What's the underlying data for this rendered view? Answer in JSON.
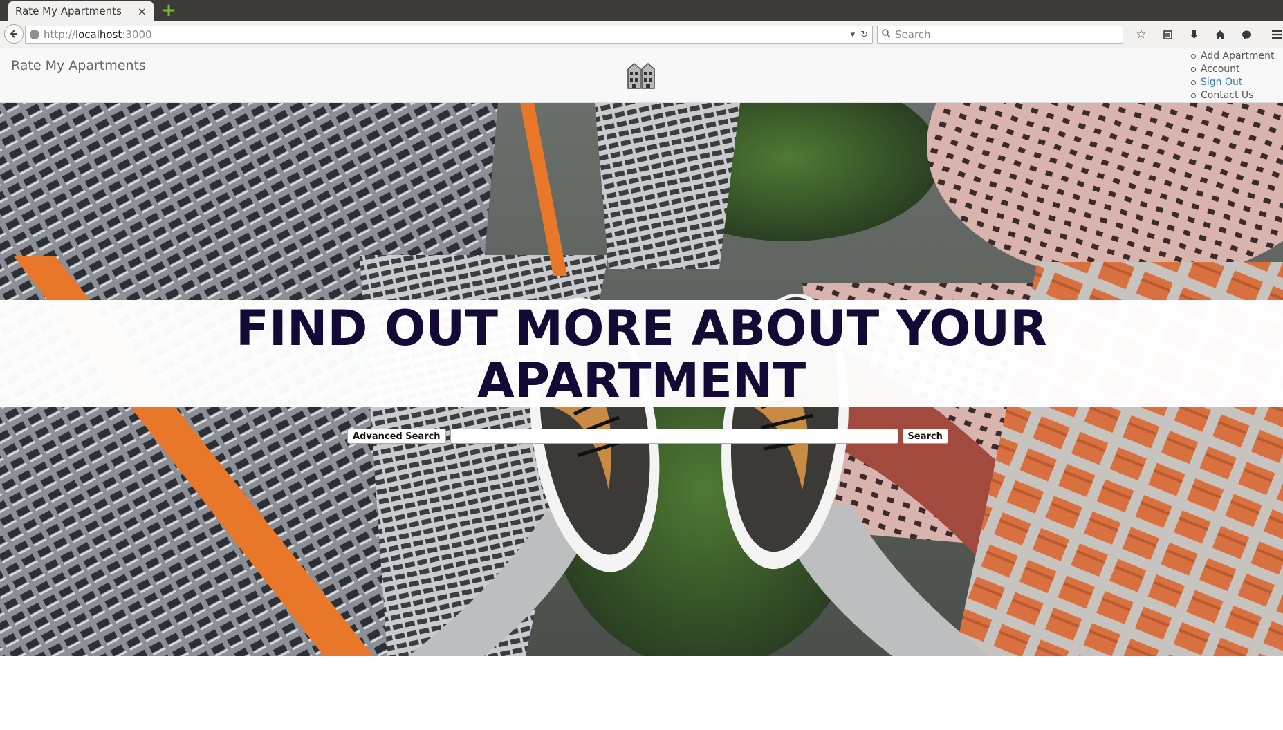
{
  "browser": {
    "tab_title": "Rate My Apartments",
    "tab_close": "×",
    "new_tab": "+",
    "url_scheme": "http://",
    "url_host": "localhost",
    "url_port": ":3000",
    "search_placeholder": "Search",
    "icons": [
      "bookmark-star-icon",
      "reading-list-icon",
      "download-icon",
      "home-icon",
      "chat-icon",
      "menu-icon"
    ]
  },
  "site": {
    "brand": "Rate My Apartments",
    "logo_icon": "building-icon",
    "nav": [
      {
        "label": "Add Apartment"
      },
      {
        "label": "Account"
      },
      {
        "label": "Sign Out"
      },
      {
        "label": "Contact Us"
      }
    ]
  },
  "hero": {
    "headline_line1": "FIND OUT MORE ABOUT YOUR",
    "headline_line2": "APARTMENT",
    "advanced_search_label": "Advanced Search",
    "search_value": "",
    "search_label": "Search"
  },
  "colors": {
    "headline": "#150a35",
    "link": "#337ab7",
    "tabbar": "#3c3b37"
  }
}
